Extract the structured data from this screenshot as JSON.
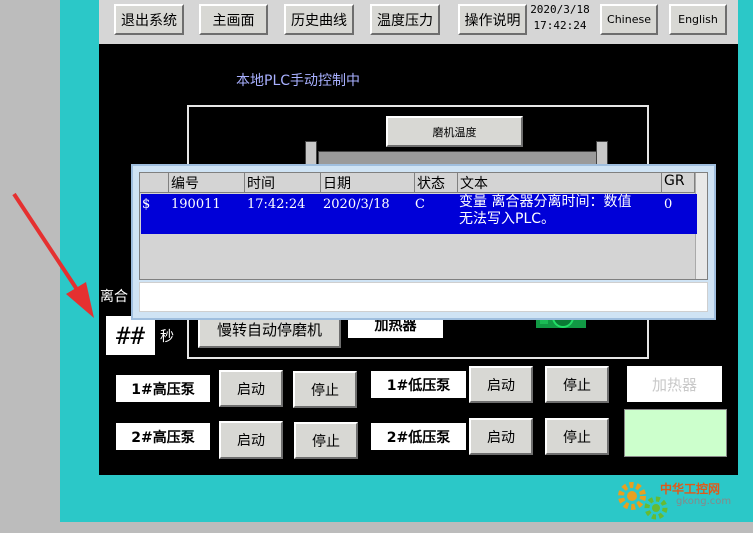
{
  "toolbar": {
    "exit": "退出系统",
    "home": "主画面",
    "history": "历史曲线",
    "temp_pressure": "温度压力",
    "manual": "操作说明",
    "date": "2020/3/18",
    "time": "17:42:24",
    "chinese": "Chinese",
    "english": "English"
  },
  "status": "本地PLC手动控制中",
  "panel": {
    "mill_temp": "磨机温度",
    "slow_stop": "慢转自动停磨机",
    "heater_mid": "加热器",
    "clutch_label": "离合",
    "hash_value": "##",
    "seconds_unit": "秒"
  },
  "alarm": {
    "headers": [
      "编号",
      "时间",
      "日期",
      "状态",
      "文本",
      "GR"
    ],
    "row": {
      "symbol": "$",
      "id": "190011",
      "time": "17:42:24",
      "date": "2020/3/18",
      "state": "C",
      "text_line1": "变量 离合器分离时间：数值",
      "text_line2": "无法写入PLC。",
      "gr": "0"
    }
  },
  "pumps": {
    "hp1": "1#高压泵",
    "hp2": "2#高压泵",
    "lp1": "1#低压泵",
    "lp2": "2#低压泵",
    "start": "启动",
    "stop": "停止",
    "heater_right": "加热器"
  },
  "watermark": {
    "cn": "中华工控网",
    "url": "gkong.com"
  },
  "colors": {
    "cyan": "#2bc8c8",
    "selection": "#0000d8",
    "indicator": "#ccffcc",
    "arrow": "#e53030"
  }
}
